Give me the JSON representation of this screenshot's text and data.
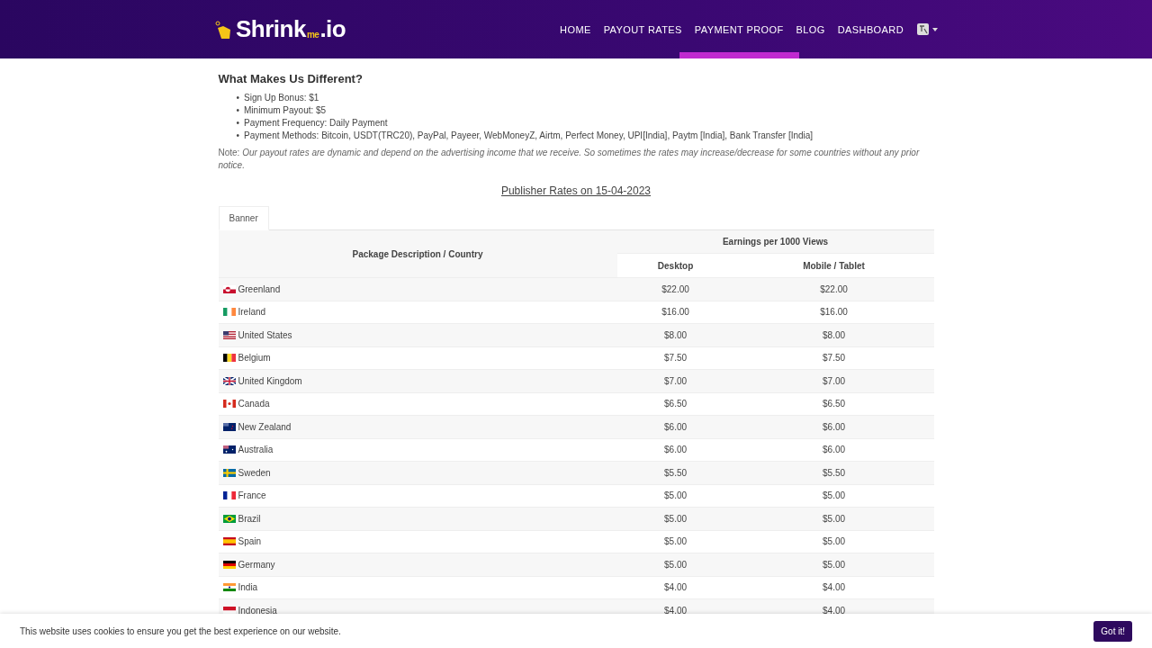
{
  "brand": {
    "name": "Shrink",
    "sub": "me",
    "suffix": ".io"
  },
  "nav": [
    {
      "label": "HOME"
    },
    {
      "label": "PAYOUT RATES"
    },
    {
      "label": "PAYMENT PROOF"
    },
    {
      "label": "BLOG"
    },
    {
      "label": "DASHBOARD"
    }
  ],
  "features": {
    "title": "What Makes Us Different?",
    "items": [
      {
        "bullet": "•",
        "text": "Sign Up Bonus: $1"
      },
      {
        "bullet": "•",
        "text": "Minimum Payout: $5"
      },
      {
        "bullet": "•",
        "text": "Payment Frequency: Daily Payment"
      },
      {
        "bullet": "•",
        "text": "Payment Methods: Bitcoin, USDT(TRC20), PayPal, Payeer, WebMoneyZ, Airtm, Perfect Money, UPI[India], Paytm [India], Bank Transfer [India]"
      }
    ],
    "note": "Note:  *Our payout rates are dynamic and depend on the advertising income that we receive. So sometimes the rates may increase/decrease for some countries without any prior notice.*"
  },
  "rates_title": "Publisher Rates on 15-04-2023",
  "tabs": [
    {
      "label": "Banner",
      "selected": true
    }
  ],
  "table": {
    "column_1": "Package Description / Country",
    "group": "Earnings per 1000 Views",
    "column_2": "Desktop",
    "column_3": "Mobile / Tablet",
    "rows": [
      {
        "country": "Greenland",
        "desktop": "$22.00",
        "mobile": "$22.00"
      },
      {
        "country": "Ireland",
        "desktop": "$16.00",
        "mobile": "$16.00"
      },
      {
        "country": "United States",
        "desktop": "$8.00",
        "mobile": "$8.00"
      },
      {
        "country": "Belgium",
        "desktop": "$7.50",
        "mobile": "$7.50"
      },
      {
        "country": "United Kingdom",
        "desktop": "$7.00",
        "mobile": "$7.00"
      },
      {
        "country": "Canada",
        "desktop": "$6.50",
        "mobile": "$6.50"
      },
      {
        "country": "New Zealand",
        "desktop": "$6.00",
        "mobile": "$6.00"
      },
      {
        "country": "Australia",
        "desktop": "$6.00",
        "mobile": "$6.00"
      },
      {
        "country": "Sweden",
        "desktop": "$5.50",
        "mobile": "$5.50"
      },
      {
        "country": "France",
        "desktop": "$5.00",
        "mobile": "$5.00"
      },
      {
        "country": "Brazil",
        "desktop": "$5.00",
        "mobile": "$5.00"
      },
      {
        "country": "Spain",
        "desktop": "$5.00",
        "mobile": "$5.00"
      },
      {
        "country": "Germany",
        "desktop": "$5.00",
        "mobile": "$5.00"
      },
      {
        "country": "India",
        "desktop": "$4.00",
        "mobile": "$4.00"
      },
      {
        "country": "Indonesia",
        "desktop": "$4.00",
        "mobile": "$4.00"
      }
    ]
  },
  "cookie": {
    "text": "This website uses cookies to ensure you get the best experience on our website.",
    "button": "Got it!"
  }
}
